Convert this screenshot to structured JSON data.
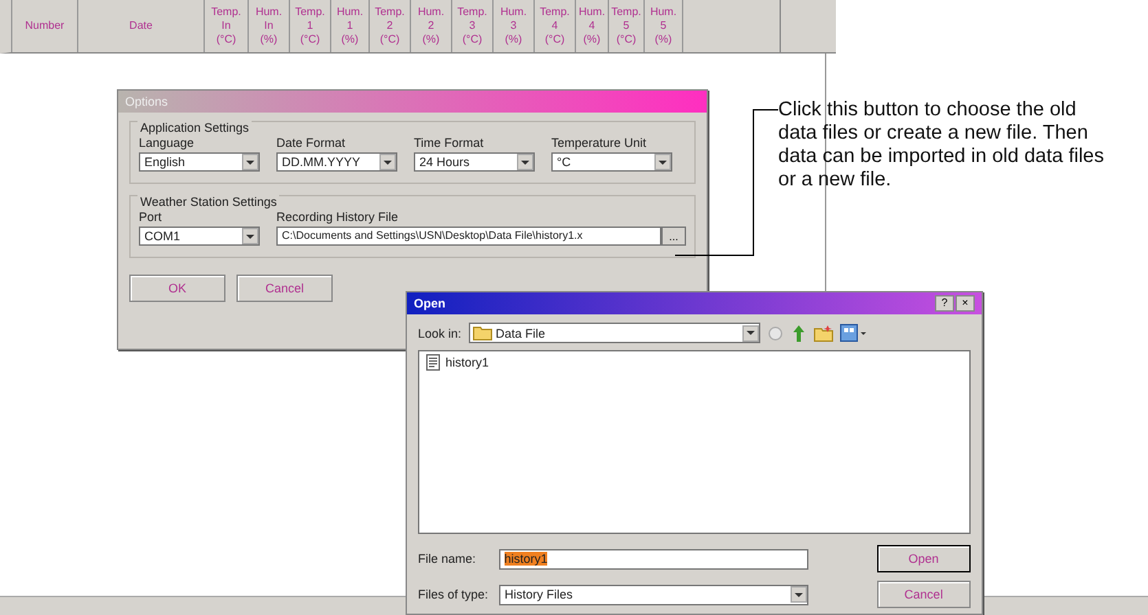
{
  "table": {
    "columns": [
      {
        "lines": [
          "Number"
        ]
      },
      {
        "lines": [
          "Date"
        ]
      },
      {
        "lines": [
          "Temp.",
          "In",
          "(°C)"
        ]
      },
      {
        "lines": [
          "Hum.",
          "In",
          "(%)"
        ]
      },
      {
        "lines": [
          "Temp.",
          "1",
          "(°C)"
        ]
      },
      {
        "lines": [
          "Hum.",
          "1",
          "(%)"
        ]
      },
      {
        "lines": [
          "Temp.",
          "2",
          "(°C)"
        ]
      },
      {
        "lines": [
          "Hum.",
          "2",
          "(%)"
        ]
      },
      {
        "lines": [
          "Temp.",
          "3",
          "(°C)"
        ]
      },
      {
        "lines": [
          "Hum.",
          "3",
          "(%)"
        ]
      },
      {
        "lines": [
          "Temp.",
          "4",
          "(°C)"
        ]
      },
      {
        "lines": [
          "Hum.",
          "4",
          "(%)"
        ]
      },
      {
        "lines": [
          "Temp.",
          "5",
          "(°C)"
        ]
      },
      {
        "lines": [
          "Hum.",
          "5",
          "(%)"
        ]
      }
    ]
  },
  "options_dialog": {
    "title": "Options",
    "application_settings": {
      "legend": "Application Settings",
      "fields": [
        {
          "label": "Language",
          "value": "English"
        },
        {
          "label": "Date Format",
          "value": "DD.MM.YYYY"
        },
        {
          "label": "Time Format",
          "value": "24 Hours"
        },
        {
          "label": "Temperature Unit",
          "value": "°C"
        }
      ]
    },
    "weather_station_settings": {
      "legend": "Weather Station Settings",
      "port": {
        "label": "Port",
        "value": "COM1"
      },
      "history_file": {
        "label": "Recording History File",
        "value": "C:\\Documents and Settings\\USN\\Desktop\\Data File\\history1.x",
        "button": "..."
      }
    },
    "buttons": [
      "OK",
      "Cancel"
    ]
  },
  "callout": {
    "text": "Click this button to choose the old data files or create a new file. Then data can be imported in old data files or a new file."
  },
  "open_dialog": {
    "title": "Open",
    "title_buttons": [
      "?",
      "×"
    ],
    "look_in": {
      "label": "Look in:",
      "value": "Data File"
    },
    "files": [
      {
        "name": "history1"
      }
    ],
    "file_name": {
      "label": "File name:",
      "value": "history1"
    },
    "file_type": {
      "label": "Files of type:",
      "value": "History Files"
    },
    "buttons": [
      "Open",
      "Cancel"
    ]
  }
}
